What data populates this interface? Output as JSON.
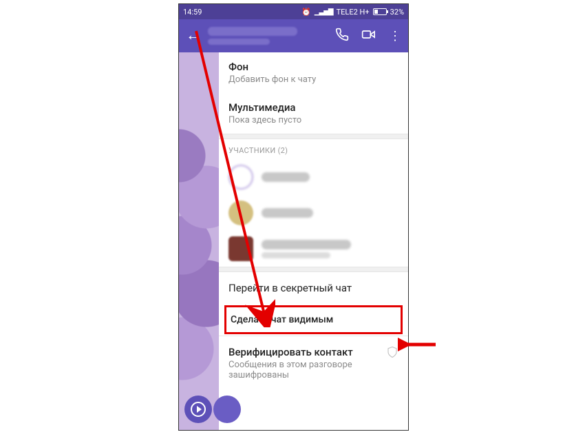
{
  "statusbar": {
    "time": "14:59",
    "carrier": "TELE2 H+",
    "battery": "32%"
  },
  "settings": {
    "background": {
      "title": "Фон",
      "subtitle": "Добавить фон к чату"
    },
    "multimedia": {
      "title": "Мультимедиа",
      "subtitle": "Пока здесь пусто"
    },
    "participants_header": "УЧАСТНИКИ (2)",
    "secret_chat": "Перейти в секретный чат",
    "make_visible": "Сделать чат видимым",
    "verify": {
      "title": "Верифицировать контакт",
      "subtitle": "Сообщения в этом разговоре зашифрованы"
    }
  },
  "annotation": {
    "color": "#e30000"
  }
}
